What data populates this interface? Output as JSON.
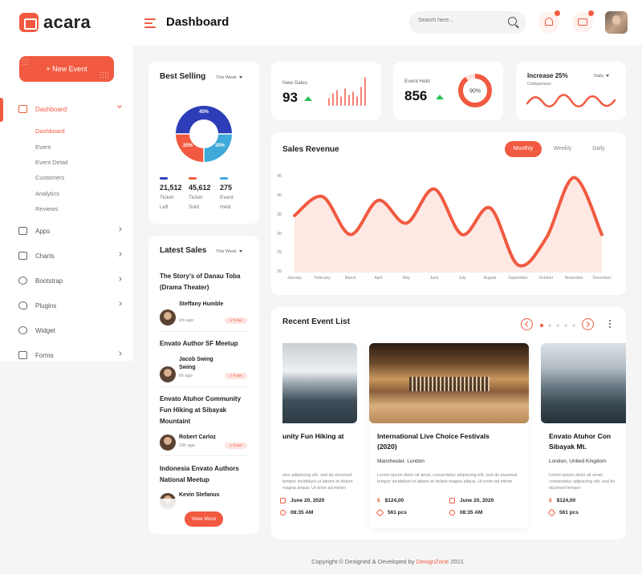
{
  "brand": {
    "name": "acara"
  },
  "header": {
    "title": "Dashboard",
    "search_placeholder": "Search here..."
  },
  "sidebar": {
    "new_event_label": "+ New Event",
    "items": [
      {
        "label": "Dashboard",
        "icon": "dashboard-icon"
      },
      {
        "label": "Apps",
        "icon": "monitor-icon"
      },
      {
        "label": "Charts",
        "icon": "sliders-icon"
      },
      {
        "label": "Bootstrap",
        "icon": "globe-icon"
      },
      {
        "label": "Plugins",
        "icon": "heart-icon"
      },
      {
        "label": "Widget",
        "icon": "settings-icon"
      },
      {
        "label": "Forms",
        "icon": "file-icon"
      }
    ],
    "sub_items": [
      "Dashboard",
      "Event",
      "Event Detail",
      "Customers",
      "Analytics",
      "Reviews"
    ]
  },
  "best_selling": {
    "title": "Best Selling",
    "period": "This Week",
    "stats": [
      {
        "value": "21,512",
        "label1": "Ticket",
        "label2": "Left",
        "color": "#2d3db7"
      },
      {
        "value": "45,612",
        "label1": "Ticket",
        "label2": "Sold",
        "color": "#f15a40"
      },
      {
        "value": "275",
        "label1": "Event",
        "label2": "Held",
        "color": "#3fa9d9"
      }
    ],
    "donut": {
      "blue": "45%",
      "red": "25%",
      "light": "30%"
    }
  },
  "latest_sales": {
    "title": "Latest Sales",
    "period": "This Week",
    "items": [
      {
        "title": "The Story’s of Danau Toba (Drama Theater)",
        "name": "Steffany Humble",
        "time": "2m ago",
        "tickets": "4 Ticket"
      },
      {
        "title": "Envato Author SF Meetup",
        "name": "Jacob Swing Swing",
        "time": "6h ago",
        "tickets": "2 Ticket"
      },
      {
        "title": "Envato Atuhor Community Fun Hiking at Sibayak Mountaint",
        "name": "Robert Carloz",
        "time": "10h ago",
        "tickets": "1 Ticket"
      },
      {
        "title": "Indonesia Envato Authors National Meetup",
        "name": "Kevin Stefanus",
        "time": "",
        "tickets": ""
      }
    ],
    "view_more": "View More"
  },
  "new_sales": {
    "label": "New Sales",
    "value": "93"
  },
  "event_held": {
    "label": "Event Held",
    "value": "856",
    "ring": "90%"
  },
  "increase": {
    "title": "Increase 25%",
    "subtitle": "Comparison",
    "period": "Daily"
  },
  "sales_revenue": {
    "title": "Sales Revenue",
    "tabs": [
      "Monthly",
      "Weekly",
      "Daily"
    ]
  },
  "chart_data": {
    "type": "area",
    "title": "Sales Revenue",
    "categories": [
      "January",
      "February",
      "March",
      "April",
      "May",
      "June",
      "July",
      "August",
      "September",
      "October",
      "November",
      "December"
    ],
    "values": [
      35,
      40,
      30,
      39,
      33,
      42,
      30,
      37,
      22,
      29,
      45,
      30
    ],
    "yticks": [
      "45",
      "40",
      "35",
      "30",
      "25",
      "20"
    ],
    "ylim": [
      20,
      47
    ],
    "color": "#f15a40"
  },
  "recent_events": {
    "title": "Recent Event List",
    "events": [
      {
        "title": "Envato Atuhor Community Fun Hiking at Sibayak Mountaint",
        "title_shown": "unity Fun Hiking at",
        "location": "",
        "desc": "atur adipiscing elit, sed do eiusmod tempor incididunt ut labore et dolore magna aliqua. Ut enim ad minim",
        "price": "",
        "date": "June 20, 2020",
        "pcs": "",
        "time": "08:35 AM"
      },
      {
        "title_line1": "International Live Choice Festivals",
        "title_line2": "(2020)",
        "location": "Manchester, London",
        "desc": "Lorem ipsum dolor sit amet, consectetur adipiscing elit, sed do eiusmod tempor incididunt ut labore et dolore magna aliqua. Ut enim ad minim",
        "price": "$124,00",
        "date": "June 20, 2020",
        "pcs": "561 pcs",
        "time": "08:35 AM"
      },
      {
        "title_line1": "Envato Atuhor Con",
        "title_line2": "Sibayak Mt.",
        "location": "London, United Kingdom",
        "desc": "Lorem ipsum dolor sit amet, consectetur adipiscing elit, sed do eiusmod tempor",
        "price": "$124,00",
        "date": "",
        "pcs": "561 pcs",
        "time": ""
      }
    ]
  },
  "footer": {
    "text": "Copyright © Designed & Developed by ",
    "brand": "DexignZone",
    "year": " 2021"
  },
  "colors": {
    "accent": "#f15a40",
    "up": "#2bc155",
    "blue": "#2d3db7",
    "light_blue": "#3fa9d9"
  }
}
